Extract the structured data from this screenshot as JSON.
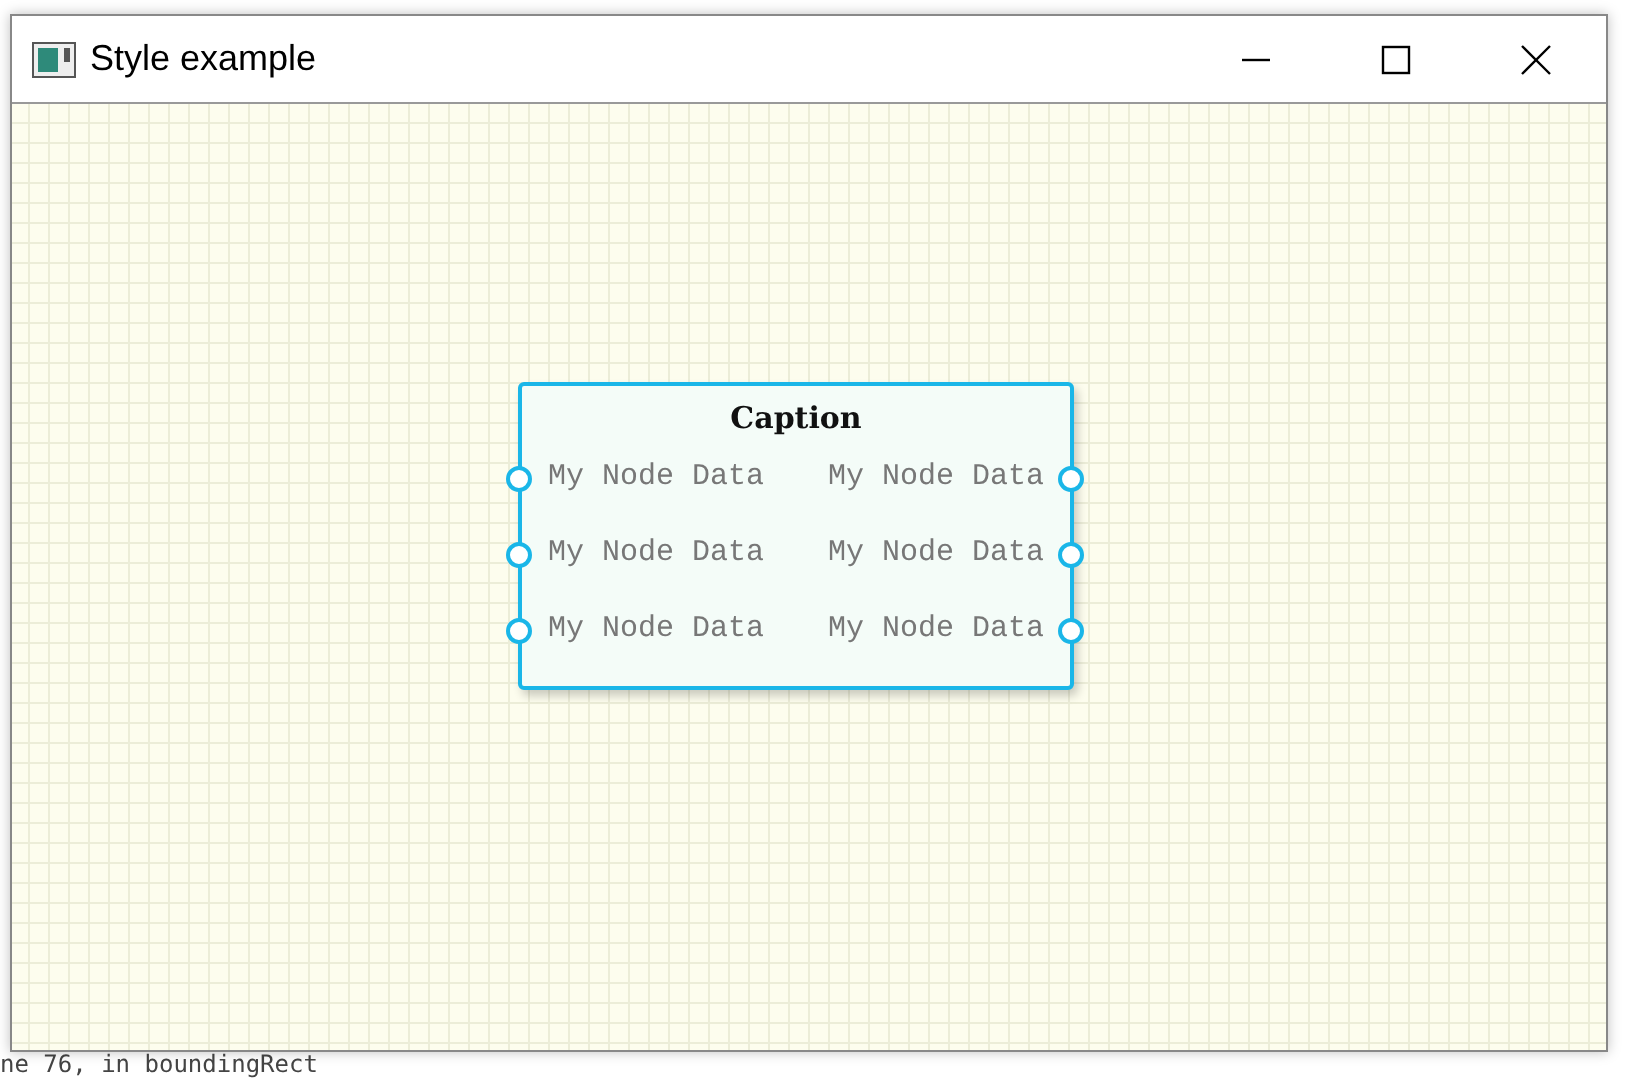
{
  "window": {
    "title": "Style example"
  },
  "node": {
    "caption": "Caption",
    "rows": [
      {
        "input": "My Node Data",
        "output": "My Node Data"
      },
      {
        "input": "My Node Data",
        "output": "My Node Data"
      },
      {
        "input": "My Node Data",
        "output": "My Node Data"
      }
    ]
  },
  "background_console": {
    "line": "ne 76, in boundingRect"
  }
}
